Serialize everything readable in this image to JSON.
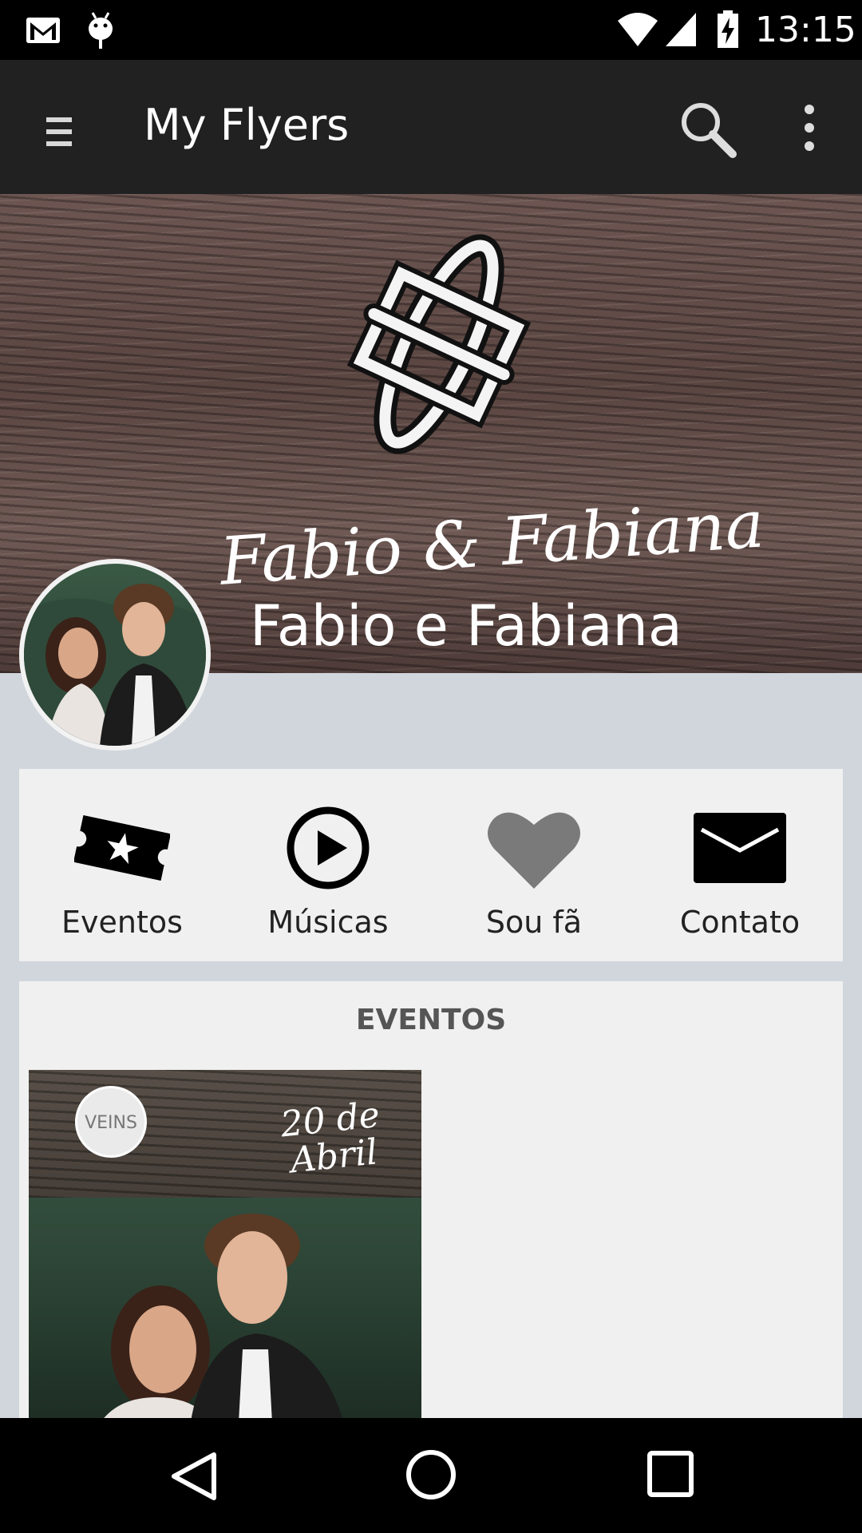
{
  "status_bar": {
    "time": "13:15",
    "icons": [
      "gmail-icon",
      "android-debug-icon",
      "wifi-icon",
      "signal-icon",
      "battery-charging-icon"
    ]
  },
  "app_bar": {
    "title": "My Flyers",
    "icons": [
      "menu-icon",
      "search-icon",
      "more-vert-icon"
    ]
  },
  "cover": {
    "script_text": "Fabio & Fabiana",
    "name": "Fabio e Fabiana",
    "logo": "monogram-logo"
  },
  "actions": [
    {
      "label": "Eventos",
      "icon": "ticket-icon"
    },
    {
      "label": "Músicas",
      "icon": "play-icon"
    },
    {
      "label": "Sou fã",
      "icon": "heart-icon"
    },
    {
      "label": "Contato",
      "icon": "mail-icon"
    }
  ],
  "events": {
    "title": "EVENTOS",
    "items": [
      {
        "date_line1": "20 de",
        "date_line2": "Abril",
        "badge": "VEINS"
      }
    ]
  },
  "nav_bar": {
    "icons": [
      "back-icon",
      "home-icon",
      "recents-icon"
    ]
  },
  "colors": {
    "app_bar": "#212121",
    "background": "#d0d6dc",
    "card": "#f0f0f0",
    "heart": "#7a7a7a"
  }
}
